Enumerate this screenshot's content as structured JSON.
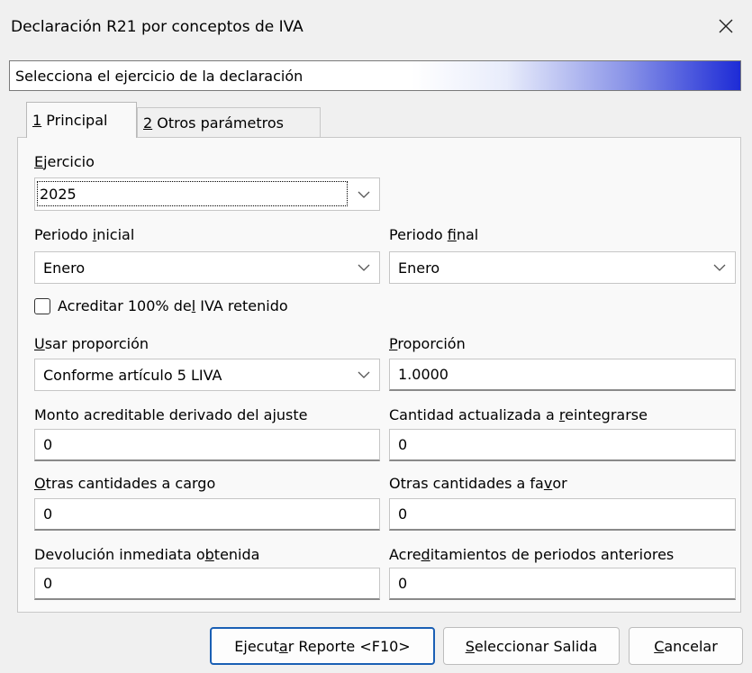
{
  "window": {
    "title": "Declaración R21 por conceptos de IVA",
    "close_icon": "close-icon"
  },
  "banner": {
    "text": "Selecciona el ejercicio de la declaración"
  },
  "tabs": [
    {
      "num": "1",
      "label": " Principal",
      "active": true
    },
    {
      "num": "2",
      "label": " Otros parámetros",
      "active": false
    }
  ],
  "form": {
    "ejercicio": {
      "label_u": "E",
      "label_rest": "jercicio",
      "value": "2025"
    },
    "periodo_inicial": {
      "label_pre": "Periodo ",
      "label_u": "i",
      "label_rest": "nicial",
      "value": "Enero"
    },
    "periodo_final": {
      "label_pre": "Periodo ",
      "label_u": "f",
      "label_rest": "inal",
      "value": "Enero"
    },
    "acreditar": {
      "label_pre": "Acreditar 100% de",
      "label_u": "l",
      "label_rest": " IVA retenido",
      "checked": false
    },
    "usar_proporcion": {
      "label_u": "U",
      "label_rest": "sar proporción",
      "value": "Conforme artículo 5 LIVA"
    },
    "proporcion": {
      "label_u": "P",
      "label_rest": "roporción",
      "value": "1.0000"
    },
    "monto_acreditable": {
      "label_pre": "Monto acreditable derivado del a",
      "label_u": "j",
      "label_rest": "uste",
      "value": "0"
    },
    "cantidad_actualizada": {
      "label_pre": "Cantidad actualizada a ",
      "label_u": "r",
      "label_rest": "eintegrarse",
      "value": "0"
    },
    "otras_cargo": {
      "label_u": "O",
      "label_rest": "tras cantidades a cargo",
      "value": "0"
    },
    "otras_favor": {
      "label_pre": "Otras cantidades a fa",
      "label_u": "v",
      "label_rest": "or",
      "value": "0"
    },
    "devolucion": {
      "label_pre": "Devolución inmediata o",
      "label_u": "b",
      "label_rest": "tenida",
      "value": "0"
    },
    "acreditamientos": {
      "label_pre": "Acre",
      "label_u": "d",
      "label_rest": "itamientos de periodos anteriores",
      "value": "0"
    }
  },
  "buttons": {
    "ejecutar": {
      "pre": "Ejecut",
      "u": "a",
      "rest": "r Reporte <F10>"
    },
    "seleccionar": {
      "pre": "",
      "u": "S",
      "rest": "eleccionar Salida"
    },
    "cancelar": {
      "pre": "",
      "u": "C",
      "rest": "ancelar"
    }
  }
}
